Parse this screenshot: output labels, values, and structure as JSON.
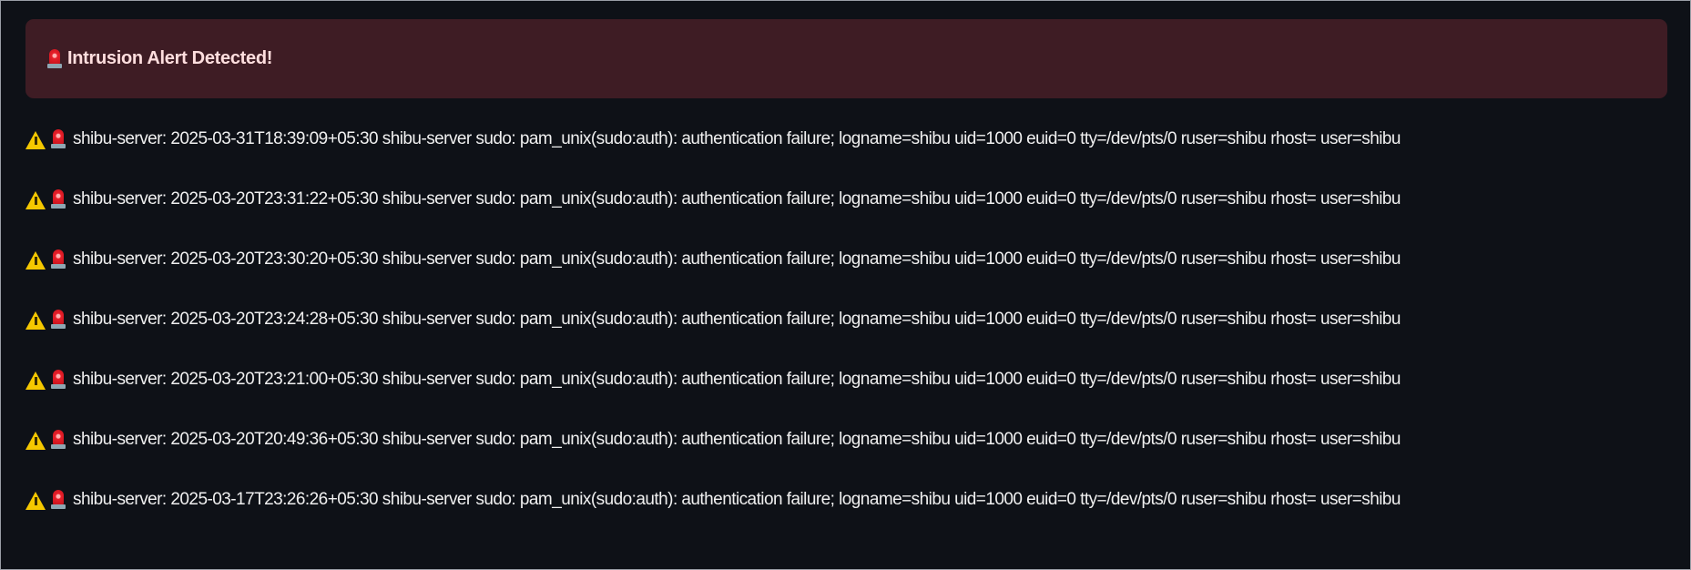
{
  "alert": {
    "icon": "police-siren-icon",
    "title": "Intrusion Alert Detected!",
    "color": "#3e1c24"
  },
  "logs": [
    {
      "text": "shibu-server: 2025-03-31T18:39:09+05:30 shibu-server sudo: pam_unix(sudo:auth): authentication failure; logname=shibu uid=1000 euid=0 tty=/dev/pts/0 ruser=shibu rhost= user=shibu"
    },
    {
      "text": "shibu-server: 2025-03-20T23:31:22+05:30 shibu-server sudo: pam_unix(sudo:auth): authentication failure; logname=shibu uid=1000 euid=0 tty=/dev/pts/0 ruser=shibu rhost= user=shibu"
    },
    {
      "text": "shibu-server: 2025-03-20T23:30:20+05:30 shibu-server sudo: pam_unix(sudo:auth): authentication failure; logname=shibu uid=1000 euid=0 tty=/dev/pts/0 ruser=shibu rhost= user=shibu"
    },
    {
      "text": "shibu-server: 2025-03-20T23:24:28+05:30 shibu-server sudo: pam_unix(sudo:auth): authentication failure; logname=shibu uid=1000 euid=0 tty=/dev/pts/0 ruser=shibu rhost= user=shibu"
    },
    {
      "text": "shibu-server: 2025-03-20T23:21:00+05:30 shibu-server sudo: pam_unix(sudo:auth): authentication failure; logname=shibu uid=1000 euid=0 tty=/dev/pts/0 ruser=shibu rhost= user=shibu"
    },
    {
      "text": "shibu-server: 2025-03-20T20:49:36+05:30 shibu-server sudo: pam_unix(sudo:auth): authentication failure; logname=shibu uid=1000 euid=0 tty=/dev/pts/0 ruser=shibu rhost= user=shibu"
    },
    {
      "text": "shibu-server: 2025-03-17T23:26:26+05:30 shibu-server sudo: pam_unix(sudo:auth): authentication failure; logname=shibu uid=1000 euid=0 tty=/dev/pts/0 ruser=shibu rhost= user=shibu"
    }
  ],
  "row_icons": [
    "warning-icon",
    "police-siren-icon"
  ]
}
